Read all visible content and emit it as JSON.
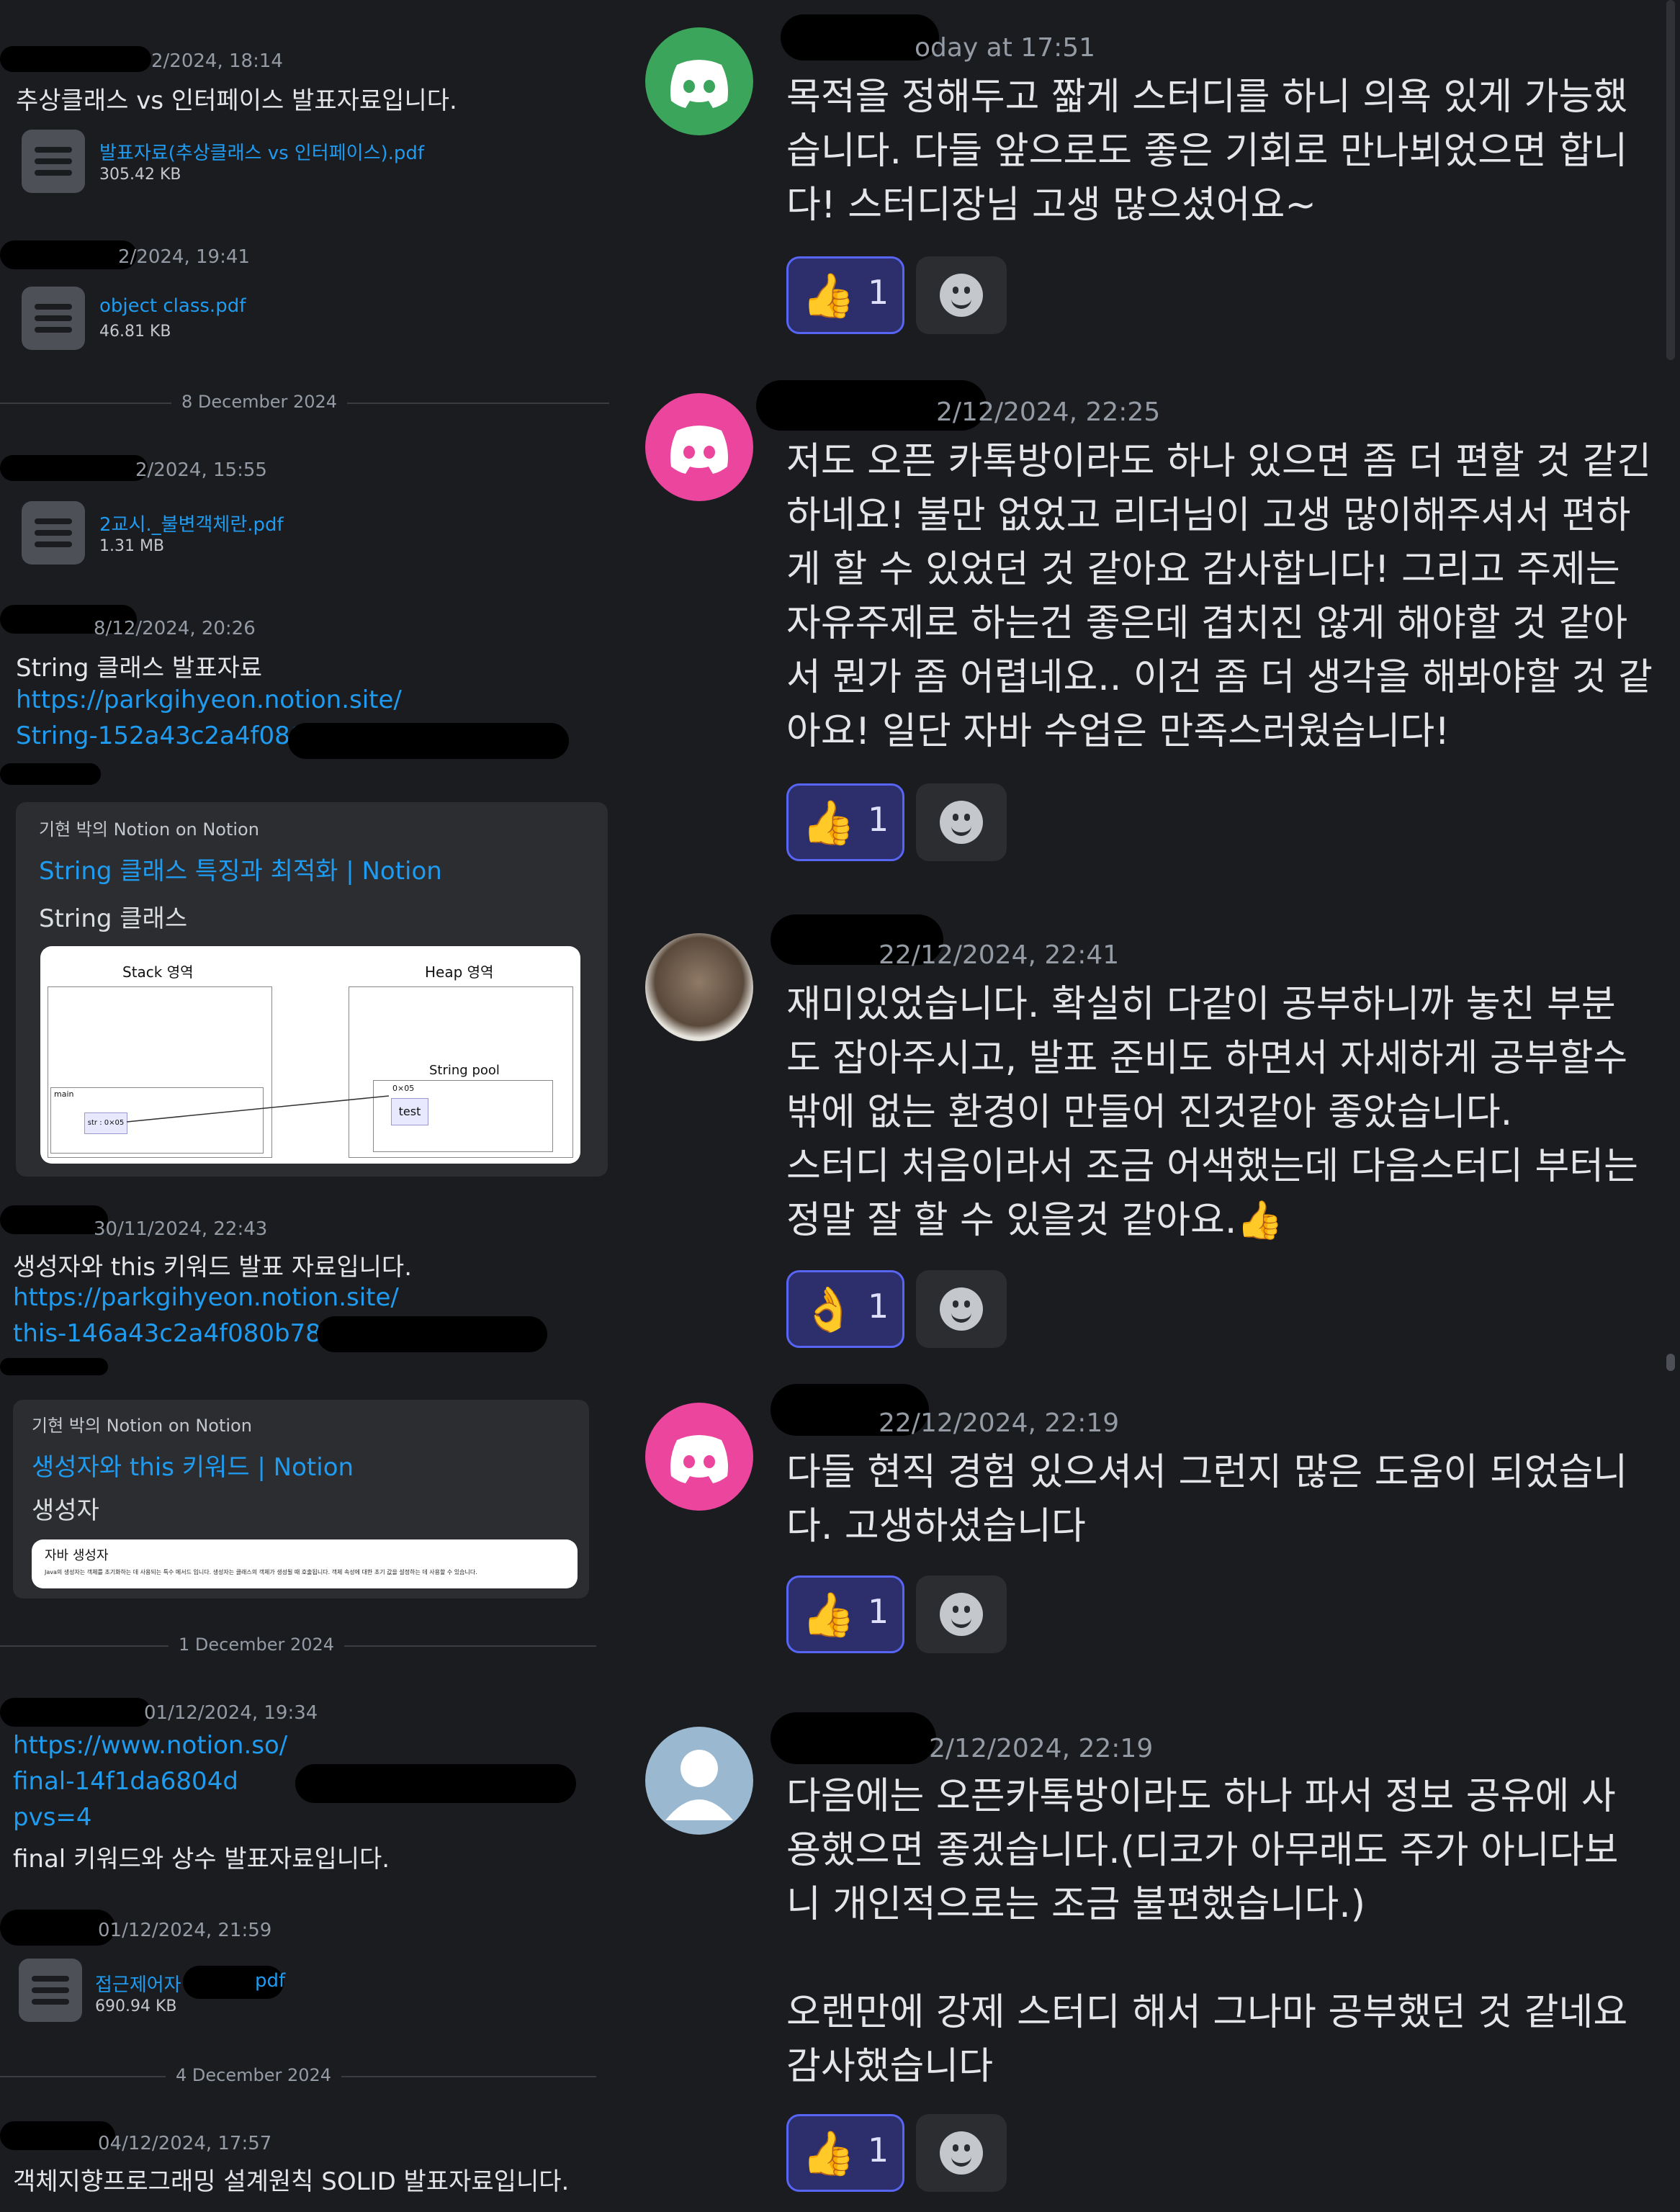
{
  "left": {
    "m1": {
      "ts": "2/2024, 18:14",
      "text": "추상클래스 vs 인터페이스 발표자료입니다.",
      "file": {
        "name": "발표자료(추상클래스 vs 인터페이스).pdf",
        "size": "305.42 KB"
      }
    },
    "m2": {
      "ts": "2/2024, 19:41",
      "file": {
        "name": "object class.pdf",
        "size": "46.81 KB"
      }
    },
    "d1": "8 December 2024",
    "m3": {
      "ts": "2/2024, 15:55",
      "file": {
        "name": "2교시._불변객체란.pdf",
        "size": "1.31 MB"
      }
    },
    "m4": {
      "ts": "8/12/2024, 20:26",
      "text": "String 클래스 발표자료",
      "link1": "https://parkgihyeon.notion.site/",
      "link2": "String-152a43c2a4f080c",
      "embed": {
        "provider": "기현 박의 Notion on Notion",
        "title": "String 클래스 특징과 최적화 | Notion",
        "desc": "String 클래스",
        "stack": "Stack 영역",
        "heap": "Heap 영역",
        "pool": "String pool",
        "main": "main",
        "str": "str : 0×05",
        "addr": "0×05",
        "test": "test"
      }
    },
    "m5": {
      "ts": "30/11/2024, 22:43",
      "text": "생성자와 this 키워드 발표 자료입니다.",
      "link1": "https://parkgihyeon.notion.site/",
      "link2": "this-146a43c2a4f080b783b",
      "embed": {
        "provider": "기현 박의 Notion on Notion",
        "title": "생성자와 this 키워드 | Notion",
        "desc": "생성자",
        "pv_title": "자바 생성자",
        "pv_text": "Java의 생성자는 객체를 초기화하는 데 사용되는 특수 메서드 입니다. 생성자는 클래스의 객체가 생성될 때 호출됩니다. 객체 속성에 대한 초기 값을 설정하는 데 사용할 수 있습니다."
      }
    },
    "d2": "1 December 2024",
    "m6": {
      "ts": "01/12/2024, 19:34",
      "link1": "https://www.notion.so/",
      "link2": "final-14f1da6804d",
      "link3": "pvs=4",
      "text": "final 키워드와 상수 발표자료입니다."
    },
    "m7": {
      "ts": "01/12/2024, 21:59",
      "file": {
        "name_a": "접근제어자",
        "name_b": "pdf",
        "size": "690.94 KB"
      }
    },
    "d3": "4 December 2024",
    "m8": {
      "ts": "04/12/2024, 17:57",
      "text": "객체지향프로그래밍 설계원칙 SOLID 발표자료입니다."
    }
  },
  "right": {
    "messages": [
      {
        "ts": "oday at 17:51",
        "lines": [
          "목적을 정해두고 짧게 스터디를 하니 의욕 있게 가능했",
          "습니다. 다들 앞으로도 좋은 기회로 만나뵈었으면 합니",
          "다! 스터디장님 고생 많으셨어요~"
        ],
        "reaction": {
          "emoji": "👍",
          "count": "1"
        },
        "avatar_color": "#3ba55c"
      },
      {
        "ts": "2/12/2024, 22:25",
        "lines": [
          "저도 오픈 카톡방이라도 하나 있으면 좀 더 편할 것 같긴",
          "하네요! 불만 없었고 리더님이 고생 많이해주셔서 편하",
          "게 할 수 있었던 것 같아요 감사합니다! 그리고 주제는",
          "자유주제로 하는건 좋은데 겹치진 않게 해야할 것 같아",
          "서 뭔가 좀 어렵네요.. 이건 좀 더 생각을 해봐야할 것 같",
          "아요! 일단 자바 수업은 만족스러웠습니다!"
        ],
        "reaction": {
          "emoji": "👍",
          "count": "1"
        },
        "avatar_color": "#eb459e"
      },
      {
        "ts": "22/12/2024, 22:41",
        "lines": [
          "재미있었습니다. 확실히 다같이 공부하니까 놓친 부분",
          "도 잡아주시고, 발표 준비도 하면서 자세하게 공부할수",
          "밖에 없는 환경이 만들어 진것같아 좋았습니다.",
          "스터디 처음이라서 조금 어색했는데 다음스터디 부터는",
          "정말 잘 할 수 있을것 같아요.👍"
        ],
        "reaction": {
          "emoji": "👌",
          "count": "1"
        },
        "avatar_color": "#6b5a4e"
      },
      {
        "ts": "22/12/2024, 22:19",
        "lines": [
          "다들 현직 경험 있으셔서 그런지 많은 도움이 되었습니",
          "다. 고생하셨습니다"
        ],
        "reaction": {
          "emoji": "👍",
          "count": "1"
        },
        "avatar_color": "#eb459e"
      },
      {
        "ts": "2/12/2024, 22:19",
        "lines": [
          "다음에는 오픈카톡방이라도 하나 파서 정보 공유에 사",
          "용했으면 좋겠습니다.(디코가 아무래도 주가 아니다보",
          "니 개인적으로는 조금 불편했습니다.)",
          "",
          "오랜만에 강제 스터디 해서 그나마 공부했던 것 같네요",
          "감사했습니다"
        ],
        "reaction": {
          "emoji": "👍",
          "count": "1"
        },
        "avatar_color": "#9ab8d0"
      }
    ]
  }
}
